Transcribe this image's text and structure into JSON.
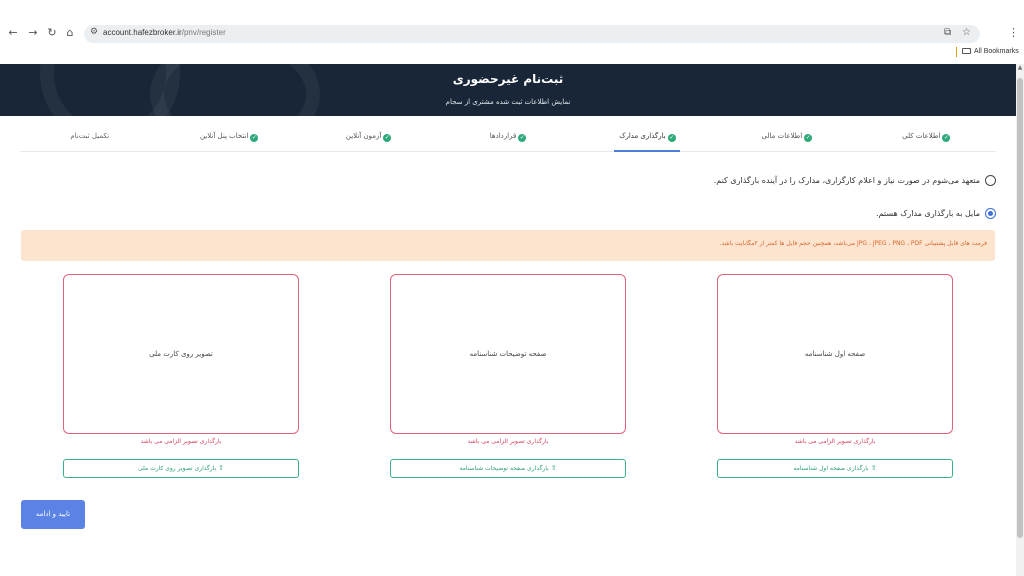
{
  "browser": {
    "url_host": "account.hafezbroker.ir",
    "url_path": "/pnv/register",
    "bookmarks_label": "All Bookmarks"
  },
  "header": {
    "title": "ثبت‌نام غیرحضوری",
    "subtitle": "نمایش اطلاعات ثبت شده مشتری از سجام"
  },
  "steps": [
    {
      "label": "اطلاعات کلی",
      "done": true
    },
    {
      "label": "اطلاعات مالی",
      "done": true
    },
    {
      "label": "بارگذاری مدارک",
      "done": true,
      "active": true
    },
    {
      "label": "قراردادها",
      "done": true
    },
    {
      "label": "آزمون آنلاین",
      "done": true
    },
    {
      "label": "انتخاب پنل آنلاین",
      "done": true
    },
    {
      "label": "تکمیل ثبت‌نام",
      "done": false
    }
  ],
  "options": {
    "later": "متعهد می‌شوم در صورت نیاز و اعلام کارگزاری، مدارک را در آینده بارگذاری کنم.",
    "now": "مایل به بارگذاری مدارک هستم."
  },
  "alert": "فرمت های قابل پشتیبانی JPG ، JPEG ، PNG ، PDF می‌باشد، همچنین حجم فایل ها کمتر از ۲مگابایت باشد.",
  "uploads": [
    {
      "box_label": "صفحه اول شناسنامه",
      "error": "بارگذاری تصویر الزامی می باشد",
      "button": "بارگذاری صفحه اول شناسنامه"
    },
    {
      "box_label": "صفحه توضیحات شناسنامه",
      "error": "بارگذاری تصویر الزامی می باشد",
      "button": "بارگذاری صفحه توضیحات شناسنامه"
    },
    {
      "box_label": "تصویر روی کارت ملی",
      "error": "بارگذاری تصویر الزامی می باشد",
      "button": "بارگذاری تصویر روی کارت ملی"
    }
  ],
  "submit": "تایید و ادامه",
  "colors": {
    "header_bg": "#182637",
    "accent": "#5b82e5",
    "success": "#2eaa7a",
    "error": "#d64160"
  }
}
